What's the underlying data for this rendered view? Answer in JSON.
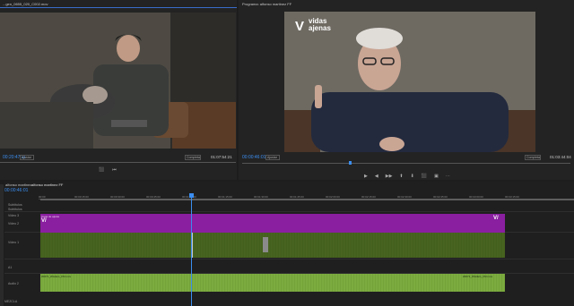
{
  "source": {
    "title": "...gen_0655_020_C002.mov",
    "timecode": "00:20:47:11",
    "fit": "Ajustar",
    "resolution": "Completa",
    "duration": "01:07:54:21",
    "controls": [
      "⬛",
      "⏮"
    ]
  },
  "program": {
    "title": "Programa: alfonso martinez FF",
    "timecode": "00:00:46:01",
    "fit": "Ajustar",
    "resolution": "Completa",
    "duration": "01:03:44:04",
    "logo_line1": "vidas",
    "logo_line2": "ajenas",
    "logo_mark": "V",
    "controls": [
      "▶",
      "◀",
      "▶▶",
      "⬆",
      "⬇",
      "⬛",
      "▣",
      "⋯"
    ]
  },
  "timeline": {
    "tab1": "alfonso martinez",
    "tab2": "alfonso martinez FF",
    "timecode": "00:00:46:01",
    "ruler_labels": [
      "00:00",
      "00:00:15:00",
      "00:00:30:00",
      "00:00:45:00",
      "00:01:00:00",
      "00:01:15:00",
      "00:01:30:00",
      "00:01:45:00",
      "00:02:00:00",
      "00:02:15:00",
      "00:02:30:00",
      "00:02:45:00",
      "00:03:00:00",
      "00:03:15:00"
    ],
    "tracks": [
      {
        "name": "Subtítulos"
      },
      {
        "name": "Subtítulos"
      },
      {
        "name": "Vídeo 3"
      },
      {
        "name": "Vídeo 2"
      },
      {
        "name": "Vídeo 1"
      },
      {
        "name": "A1"
      },
      {
        "name": "Audio 2"
      }
    ],
    "v2_clip_label": "Capa de ajuste",
    "v2_logo": "V/",
    "a2_clip1": "20071_Wistlers_FM.mov",
    "a2_clip2": "20071_Wistlers_FM.mov",
    "mix_label": "MEZCLA"
  }
}
